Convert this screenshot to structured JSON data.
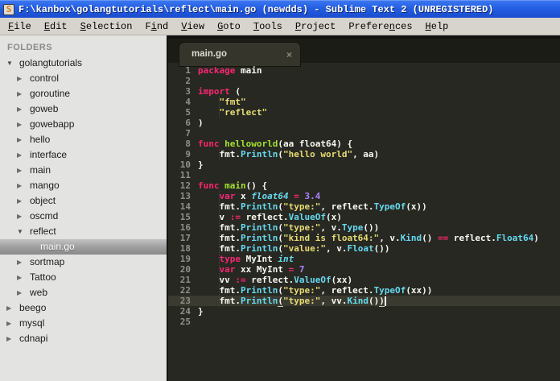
{
  "window": {
    "title": "F:\\kanbox\\golangtutorials\\reflect\\main.go (newdds) - Sublime Text 2 (UNREGISTERED)",
    "icon_letter": "S"
  },
  "menu": {
    "items": [
      {
        "label": "File",
        "mnemonic": 0
      },
      {
        "label": "Edit",
        "mnemonic": 0
      },
      {
        "label": "Selection",
        "mnemonic": 0
      },
      {
        "label": "Find",
        "mnemonic": 1
      },
      {
        "label": "View",
        "mnemonic": 0
      },
      {
        "label": "Goto",
        "mnemonic": 0
      },
      {
        "label": "Tools",
        "mnemonic": 0
      },
      {
        "label": "Project",
        "mnemonic": 0
      },
      {
        "label": "Preferences",
        "mnemonic": 7
      },
      {
        "label": "Help",
        "mnemonic": 0
      }
    ]
  },
  "sidebar": {
    "header": "FOLDERS",
    "items": [
      {
        "label": "golangtutorials",
        "depth": 0,
        "state": "expanded",
        "selected": false
      },
      {
        "label": "control",
        "depth": 1,
        "state": "collapsed",
        "selected": false
      },
      {
        "label": "goroutine",
        "depth": 1,
        "state": "collapsed",
        "selected": false
      },
      {
        "label": "goweb",
        "depth": 1,
        "state": "collapsed",
        "selected": false
      },
      {
        "label": "gowebapp",
        "depth": 1,
        "state": "collapsed",
        "selected": false
      },
      {
        "label": "hello",
        "depth": 1,
        "state": "collapsed",
        "selected": false
      },
      {
        "label": "interface",
        "depth": 1,
        "state": "collapsed",
        "selected": false
      },
      {
        "label": "main",
        "depth": 1,
        "state": "collapsed",
        "selected": false
      },
      {
        "label": "mango",
        "depth": 1,
        "state": "collapsed",
        "selected": false
      },
      {
        "label": "object",
        "depth": 1,
        "state": "collapsed",
        "selected": false
      },
      {
        "label": "oscmd",
        "depth": 1,
        "state": "collapsed",
        "selected": false
      },
      {
        "label": "reflect",
        "depth": 1,
        "state": "expanded",
        "selected": false
      },
      {
        "label": "main.go",
        "depth": 2,
        "state": "file",
        "selected": true
      },
      {
        "label": "sortmap",
        "depth": 1,
        "state": "collapsed",
        "selected": false
      },
      {
        "label": "Tattoo",
        "depth": 1,
        "state": "collapsed",
        "selected": false
      },
      {
        "label": "web",
        "depth": 1,
        "state": "collapsed",
        "selected": false
      },
      {
        "label": "beego",
        "depth": 0,
        "state": "collapsed",
        "selected": false
      },
      {
        "label": "mysql",
        "depth": 0,
        "state": "collapsed",
        "selected": false
      },
      {
        "label": "cdnapi",
        "depth": 0,
        "state": "collapsed",
        "selected": false
      }
    ]
  },
  "editor": {
    "tab": {
      "label": "main.go",
      "close": "×"
    },
    "current_line": 23,
    "caret_line": 23,
    "indent_guides": [
      [
        4,
        5
      ],
      [
        9,
        9
      ],
      [
        13,
        23
      ]
    ],
    "colors": {
      "background": "#272822",
      "keyword": "#f92672",
      "function": "#a6e22e",
      "string": "#e6db74",
      "support": "#66d9ef",
      "number": "#ae81ff",
      "plain": "#f8f8f2",
      "line_numbers": "#8f908a",
      "current_line_bg": "#3b3a30"
    },
    "lines": [
      [
        [
          "package",
          "k"
        ],
        [
          " main",
          "p"
        ]
      ],
      [],
      [
        [
          "import",
          "k"
        ],
        [
          " (",
          "p"
        ]
      ],
      [
        [
          "    ",
          "p"
        ],
        [
          "\"fmt\"",
          "s"
        ]
      ],
      [
        [
          "    ",
          "p"
        ],
        [
          "\"reflect\"",
          "s"
        ]
      ],
      [
        [
          ")",
          "p"
        ]
      ],
      [],
      [
        [
          "func",
          "k"
        ],
        [
          " ",
          "p"
        ],
        [
          "helloworld",
          "f"
        ],
        [
          "(aa float64) {",
          "p"
        ]
      ],
      [
        [
          "    fmt.",
          "p"
        ],
        [
          "Println",
          "m"
        ],
        [
          "(",
          "p"
        ],
        [
          "\"hello world\"",
          "s"
        ],
        [
          ", aa)",
          "p"
        ]
      ],
      [
        [
          "}",
          "p"
        ]
      ],
      [],
      [
        [
          "func",
          "k"
        ],
        [
          " ",
          "p"
        ],
        [
          "main",
          "f"
        ],
        [
          "() {",
          "p"
        ]
      ],
      [
        [
          "    ",
          "p"
        ],
        [
          "var",
          "k"
        ],
        [
          " x ",
          "p"
        ],
        [
          "float64",
          "t"
        ],
        [
          " ",
          "p"
        ],
        [
          "=",
          "k"
        ],
        [
          " ",
          "p"
        ],
        [
          "3.4",
          "n"
        ]
      ],
      [
        [
          "    fmt.",
          "p"
        ],
        [
          "Println",
          "m"
        ],
        [
          "(",
          "p"
        ],
        [
          "\"type:\"",
          "s"
        ],
        [
          ", reflect.",
          "p"
        ],
        [
          "TypeOf",
          "m"
        ],
        [
          "(x))",
          "p"
        ]
      ],
      [
        [
          "    v ",
          "p"
        ],
        [
          ":=",
          "k"
        ],
        [
          " reflect.",
          "p"
        ],
        [
          "ValueOf",
          "m"
        ],
        [
          "(x)",
          "p"
        ]
      ],
      [
        [
          "    fmt.",
          "p"
        ],
        [
          "Println",
          "m"
        ],
        [
          "(",
          "p"
        ],
        [
          "\"type:\"",
          "s"
        ],
        [
          ", v.",
          "p"
        ],
        [
          "Type",
          "m"
        ],
        [
          "())",
          "p"
        ]
      ],
      [
        [
          "    fmt.",
          "p"
        ],
        [
          "Println",
          "m"
        ],
        [
          "(",
          "p"
        ],
        [
          "\"kind is float64:\"",
          "s"
        ],
        [
          ", v.",
          "p"
        ],
        [
          "Kind",
          "m"
        ],
        [
          "() ",
          "p"
        ],
        [
          "==",
          "k"
        ],
        [
          " reflect.",
          "p"
        ],
        [
          "Float64",
          "m"
        ],
        [
          ")",
          "p"
        ]
      ],
      [
        [
          "    fmt.",
          "p"
        ],
        [
          "Println",
          "m"
        ],
        [
          "(",
          "p"
        ],
        [
          "\"value:\"",
          "s"
        ],
        [
          ", v.",
          "p"
        ],
        [
          "Float",
          "m"
        ],
        [
          "())",
          "p"
        ]
      ],
      [
        [
          "    ",
          "p"
        ],
        [
          "type",
          "k"
        ],
        [
          " MyInt ",
          "p"
        ],
        [
          "int",
          "t"
        ]
      ],
      [
        [
          "    ",
          "p"
        ],
        [
          "var",
          "k"
        ],
        [
          " xx MyInt ",
          "p"
        ],
        [
          "=",
          "k"
        ],
        [
          " ",
          "p"
        ],
        [
          "7",
          "n"
        ]
      ],
      [
        [
          "    vv ",
          "p"
        ],
        [
          ":=",
          "k"
        ],
        [
          " reflect.",
          "p"
        ],
        [
          "ValueOf",
          "m"
        ],
        [
          "(xx)",
          "p"
        ]
      ],
      [
        [
          "    fmt.",
          "p"
        ],
        [
          "Println",
          "m"
        ],
        [
          "(",
          "p"
        ],
        [
          "\"type:\"",
          "s"
        ],
        [
          ", reflect.",
          "p"
        ],
        [
          "TypeOf",
          "m"
        ],
        [
          "(xx))",
          "p"
        ]
      ],
      [
        [
          "    fmt.",
          "p"
        ],
        [
          "Println",
          "m"
        ],
        [
          "(",
          "p",
          "u"
        ],
        [
          "\"type:\"",
          "s"
        ],
        [
          ", vv.",
          "p"
        ],
        [
          "Kind",
          "m"
        ],
        [
          "()",
          "p"
        ],
        [
          ")",
          "p",
          "u"
        ]
      ],
      [
        [
          "}",
          "p"
        ]
      ],
      []
    ]
  }
}
